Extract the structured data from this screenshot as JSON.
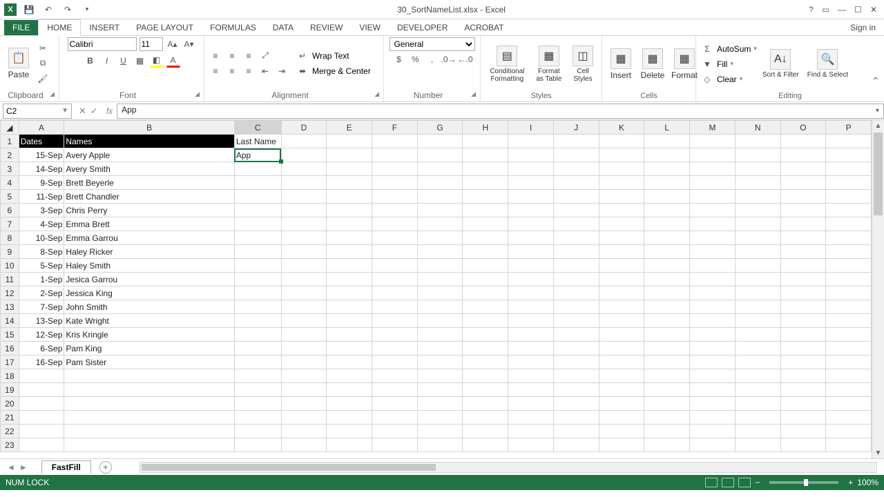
{
  "title": "30_SortNameList.xlsx - Excel",
  "signin": "Sign in",
  "tabs": {
    "file": "FILE",
    "home": "HOME",
    "insert": "INSERT",
    "pagelayout": "PAGE LAYOUT",
    "formulas": "FORMULAS",
    "data": "DATA",
    "review": "REVIEW",
    "view": "VIEW",
    "developer": "DEVELOPER",
    "acrobat": "ACROBAT"
  },
  "ribbon": {
    "clipboard": {
      "paste": "Paste",
      "label": "Clipboard"
    },
    "font": {
      "name": "Calibri",
      "size": "11",
      "label": "Font"
    },
    "alignment": {
      "wrap": "Wrap Text",
      "merge": "Merge & Center",
      "label": "Alignment"
    },
    "number": {
      "format": "General",
      "label": "Number"
    },
    "styles": {
      "cond": "Conditional Formatting",
      "table": "Format as Table",
      "cell": "Cell Styles",
      "label": "Styles"
    },
    "cells": {
      "insert": "Insert",
      "delete": "Delete",
      "format": "Format",
      "label": "Cells"
    },
    "editing": {
      "sum": "AutoSum",
      "fill": "Fill",
      "clear": "Clear",
      "sort": "Sort & Filter",
      "find": "Find & Select",
      "label": "Editing"
    }
  },
  "nameBox": "C2",
  "formula": "App",
  "columns": [
    "A",
    "B",
    "C",
    "D",
    "E",
    "F",
    "G",
    "H",
    "I",
    "J",
    "K",
    "L",
    "M",
    "N",
    "O",
    "P"
  ],
  "headerRow": {
    "A": "Dates",
    "B": "Names",
    "C": "Last Name"
  },
  "activeCellValue": "App",
  "chart_data": {
    "type": "table",
    "columns": [
      "Dates",
      "Names",
      "Last Name"
    ],
    "rows": [
      [
        "15-Sep",
        "Avery Apple",
        "App"
      ],
      [
        "14-Sep",
        "Avery Smith",
        ""
      ],
      [
        "9-Sep",
        "Brett Beyerle",
        ""
      ],
      [
        "11-Sep",
        "Brett Chandler",
        ""
      ],
      [
        "3-Sep",
        "Chris Perry",
        ""
      ],
      [
        "4-Sep",
        "Emma Brett",
        ""
      ],
      [
        "10-Sep",
        "Emma Garrou",
        ""
      ],
      [
        "8-Sep",
        "Haley Ricker",
        ""
      ],
      [
        "5-Sep",
        "Haley Smith",
        ""
      ],
      [
        "1-Sep",
        "Jesica Garrou",
        ""
      ],
      [
        "2-Sep",
        "Jessica King",
        ""
      ],
      [
        "7-Sep",
        "John Smith",
        ""
      ],
      [
        "13-Sep",
        "Kate Wright",
        ""
      ],
      [
        "12-Sep",
        "Kris Kringle",
        ""
      ],
      [
        "6-Sep",
        "Pam King",
        ""
      ],
      [
        "16-Sep",
        "Pam Sister",
        ""
      ]
    ]
  },
  "sheet": "FastFill",
  "status": {
    "numlock": "NUM LOCK",
    "zoom": "100%"
  }
}
